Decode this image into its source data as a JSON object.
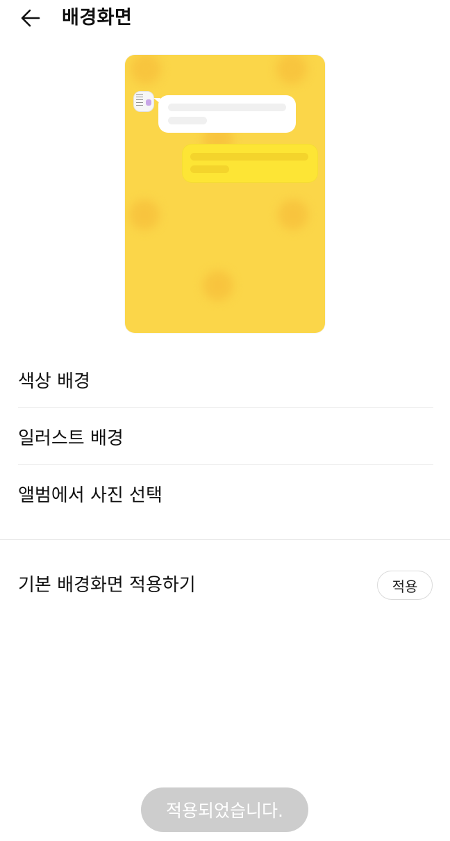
{
  "header": {
    "title": "배경화면",
    "back_icon": "arrow-left-icon"
  },
  "preview": {
    "background_color": "#fbd649",
    "incoming_bubble_color": "#ffffff",
    "outgoing_bubble_color": "#fde535"
  },
  "menu": {
    "items": [
      {
        "label": "색상 배경"
      },
      {
        "label": "일러스트 배경"
      },
      {
        "label": "앨범에서 사진 선택"
      }
    ]
  },
  "default_background": {
    "label": "기본 배경화면 적용하기",
    "apply_label": "적용"
  },
  "toast": {
    "message": "적용되었습니다."
  }
}
